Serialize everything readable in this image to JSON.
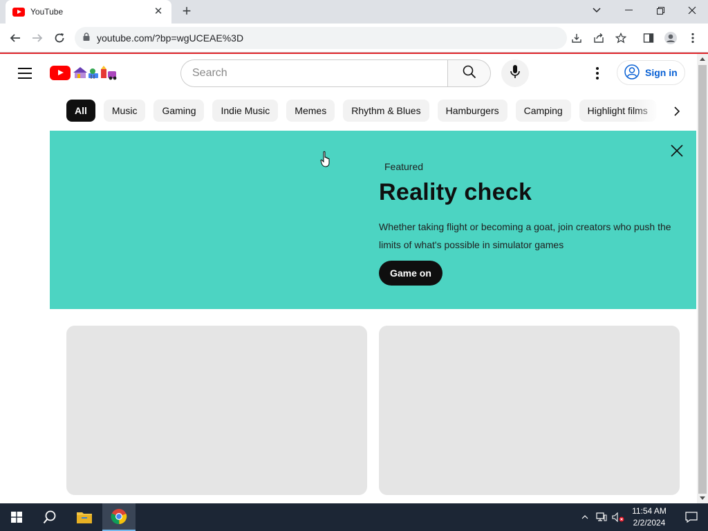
{
  "browser": {
    "tab_title": "YouTube",
    "url": "youtube.com/?bp=wgUCEAE%3D",
    "accent_red": "#e0272c"
  },
  "youtube": {
    "search_placeholder": "Search",
    "sign_in_label": "Sign in",
    "chips": [
      "All",
      "Music",
      "Gaming",
      "Indie Music",
      "Memes",
      "Rhythm & Blues",
      "Hamburgers",
      "Camping",
      "Highlight films"
    ],
    "active_chip": "All",
    "banner": {
      "eyebrow": "Featured",
      "title": "Reality check",
      "description": "Whether taking flight or becoming a goat, join creators who push the limits of what's possible in simulator games",
      "cta_label": "Game on",
      "background_color": "#4cd4c2"
    }
  },
  "taskbar": {
    "time": "11:54 AM",
    "date": "2/2/2024"
  }
}
